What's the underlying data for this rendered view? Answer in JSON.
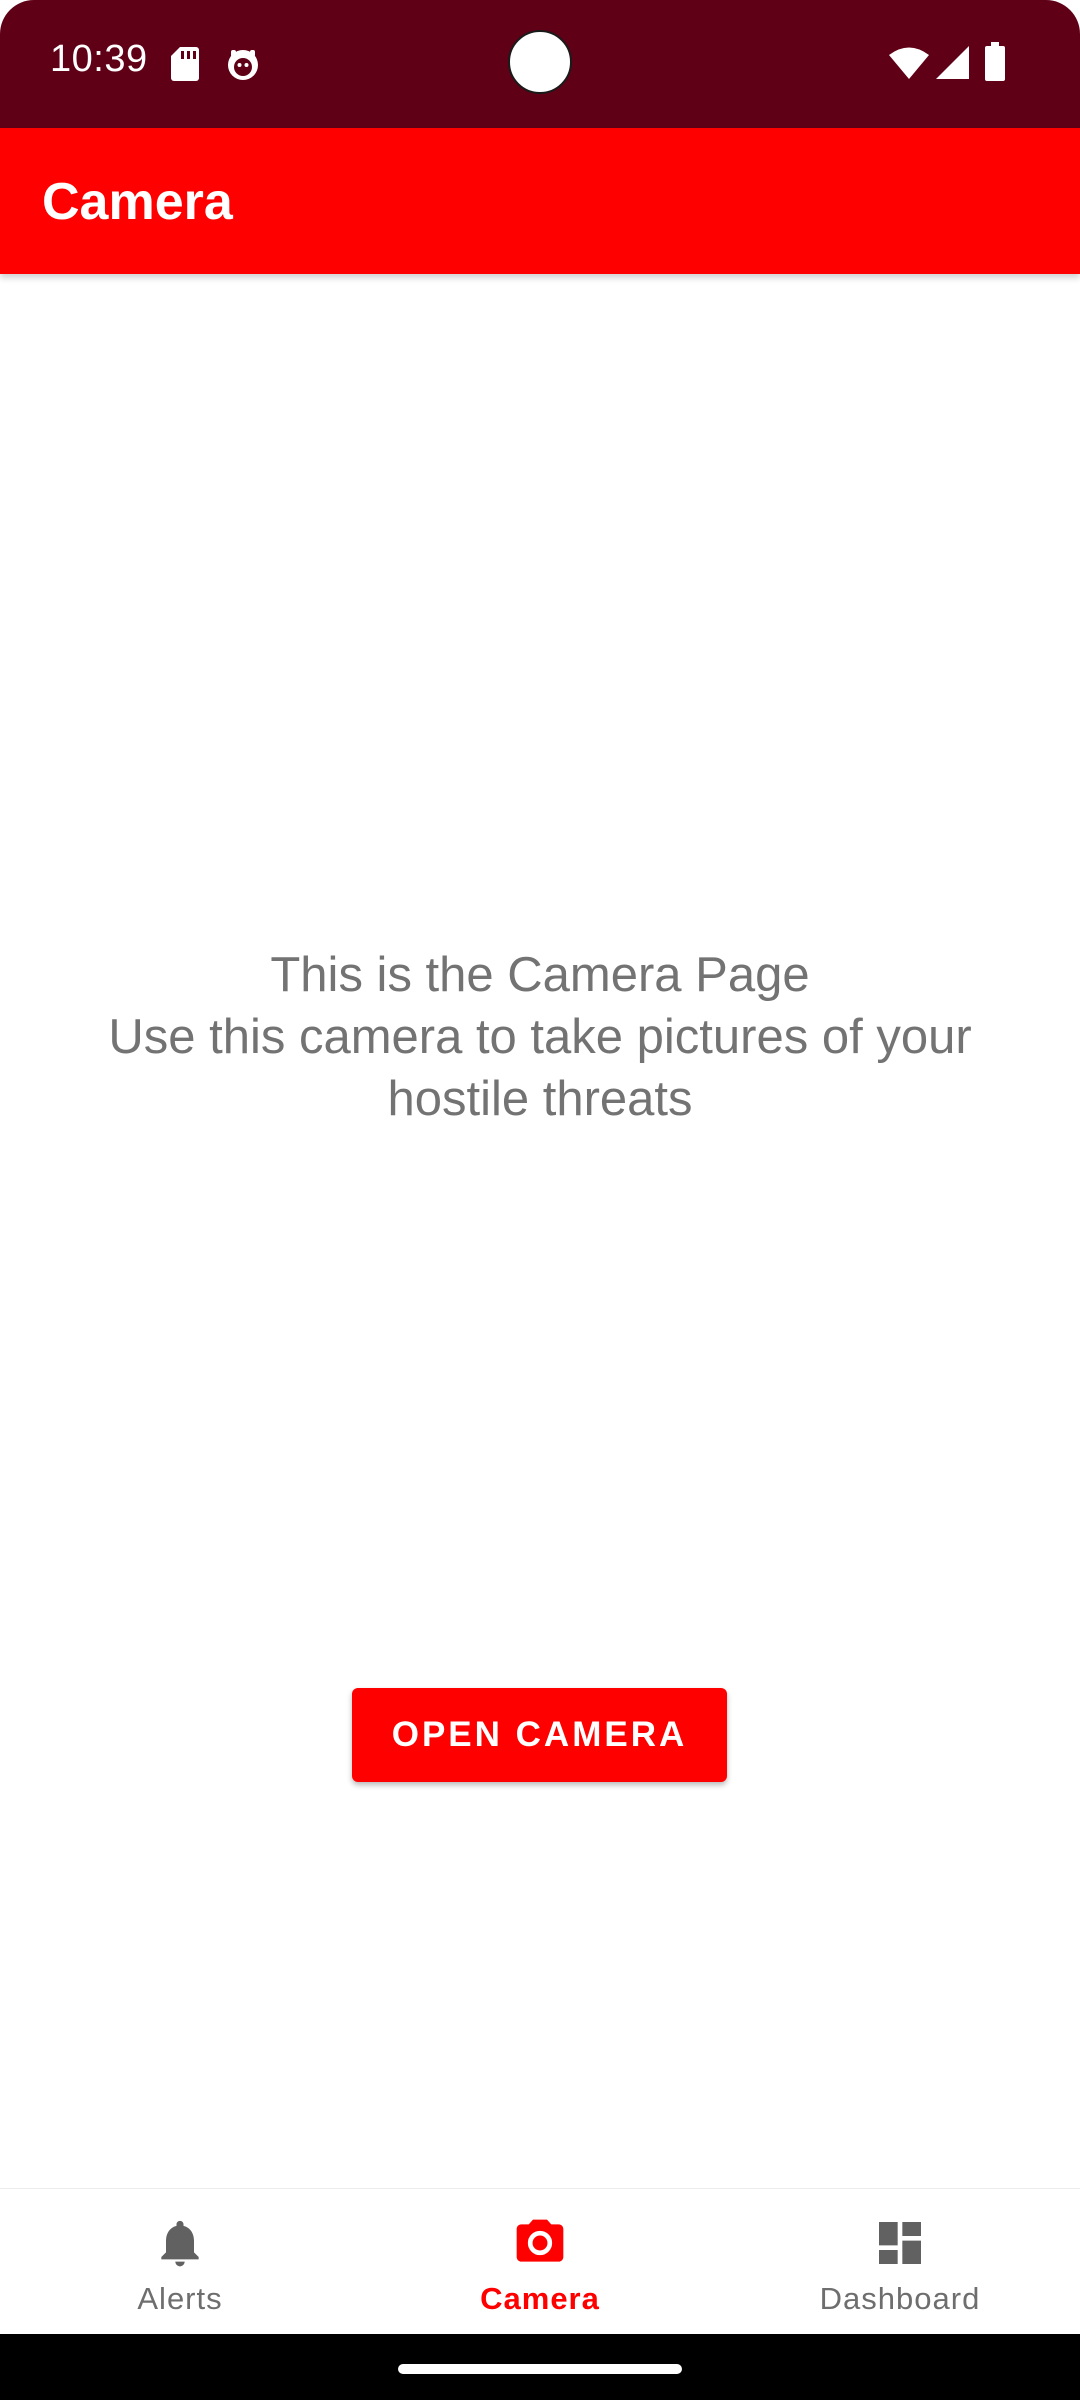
{
  "status_bar": {
    "time": "10:39",
    "icons": [
      "sd-card-icon",
      "notification-icon",
      "wifi-icon",
      "signal-icon",
      "battery-icon"
    ],
    "background_color": "#5f0016"
  },
  "app_bar": {
    "title": "Camera",
    "background_color": "#ff0000"
  },
  "main": {
    "message_lines": [
      "This is the Camera Page",
      "Use this camera to take pictures of your",
      "hostile threats"
    ],
    "open_camera_label": "OPEN CAMERA"
  },
  "bottom_nav": {
    "items": [
      {
        "label": "Alerts",
        "icon": "bell-icon",
        "active": false
      },
      {
        "label": "Camera",
        "icon": "camera-icon",
        "active": true
      },
      {
        "label": "Dashboard",
        "icon": "dashboard-icon",
        "active": false
      }
    ],
    "active_color": "#ff0000",
    "inactive_color": "#6e6e6e"
  }
}
